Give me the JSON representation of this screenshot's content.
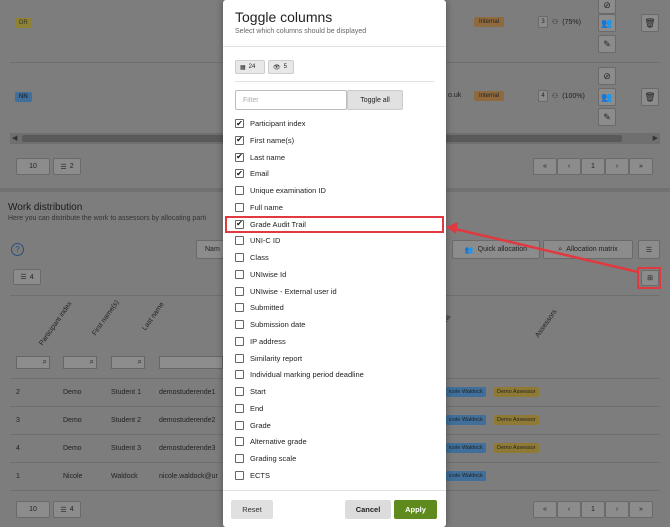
{
  "background": {
    "rows": [
      {
        "badge": "DR",
        "badge_color": "yellow",
        "tag": "Internal",
        "count": "3",
        "percent": "(75%)"
      },
      {
        "badge": "NN",
        "badge_color": "blue",
        "tag": "Internal",
        "count": "4",
        "percent": "(100%)",
        "email_suffix": "o.uk"
      }
    ],
    "pager_top": {
      "per_page": "10",
      "columns_count": "2",
      "page": "1"
    },
    "work_distribution": {
      "title": "Work distribution",
      "description": "Here you can distribute the work to assessors by allocating parti",
      "name_button_prefix": "Nam",
      "quick_allocation": "Quick allocation",
      "allocation_matrix": "Allocation matrix",
      "columns_count": "4"
    },
    "table": {
      "headers": [
        "Participant index",
        "First name(s)",
        "Last name"
      ],
      "rows": [
        {
          "index": "2",
          "first": "Demo",
          "last": "Student 1",
          "email": "demostuderende1",
          "assessor": "Demo Assessor",
          "chip": "icole Waldock"
        },
        {
          "index": "3",
          "first": "Demo",
          "last": "Student 2",
          "email": "demostuderende2",
          "assessor": "Demo Assessor",
          "chip": "icole Waldock"
        },
        {
          "index": "4",
          "first": "Demo",
          "last": "Student 3",
          "email": "demostuderende3",
          "assessor": "Demo Assessor",
          "chip": "icole Waldock"
        },
        {
          "index": "1",
          "first": "Nicole",
          "last": "Waldock",
          "email": "nicole.waldock@ur",
          "assessor": "",
          "chip": "icole Waldock"
        }
      ],
      "assessors_header": "Assessors",
      "ons_header": "ons"
    },
    "pager_bottom": {
      "per_page": "10",
      "columns_count": "4",
      "page": "1"
    }
  },
  "modal": {
    "title": "Toggle columns",
    "subtitle": "Select which columns should be displayed",
    "chips": [
      {
        "icon": "table-icon",
        "value": "24"
      },
      {
        "icon": "eye-icon",
        "value": "5"
      }
    ],
    "filter_placeholder": "Filter",
    "toggle_all_label": "Toggle all",
    "columns": [
      {
        "label": "Participant index",
        "checked": true
      },
      {
        "label": "First name(s)",
        "checked": true
      },
      {
        "label": "Last name",
        "checked": true
      },
      {
        "label": "Email",
        "checked": true
      },
      {
        "label": "Unique examination ID",
        "checked": false
      },
      {
        "label": "Full name",
        "checked": false
      },
      {
        "label": "Grade Audit Trail",
        "checked": true
      },
      {
        "label": "UNI-C ID",
        "checked": false
      },
      {
        "label": "Class",
        "checked": false
      },
      {
        "label": "UNIwise Id",
        "checked": false
      },
      {
        "label": "UNIwise - External user id",
        "checked": false
      },
      {
        "label": "Submitted",
        "checked": false
      },
      {
        "label": "Submission date",
        "checked": false
      },
      {
        "label": "IP address",
        "checked": false
      },
      {
        "label": "Similarity report",
        "checked": false
      },
      {
        "label": "Individual marking period deadline",
        "checked": false
      },
      {
        "label": "Start",
        "checked": false
      },
      {
        "label": "End",
        "checked": false
      },
      {
        "label": "Grade",
        "checked": false
      },
      {
        "label": "Alternative grade",
        "checked": false
      },
      {
        "label": "Grading scale",
        "checked": false
      },
      {
        "label": "ECTS",
        "checked": false
      }
    ],
    "buttons": {
      "reset": "Reset",
      "cancel": "Cancel",
      "apply": "Apply"
    }
  },
  "annotation": {
    "color": "#e0393f"
  }
}
